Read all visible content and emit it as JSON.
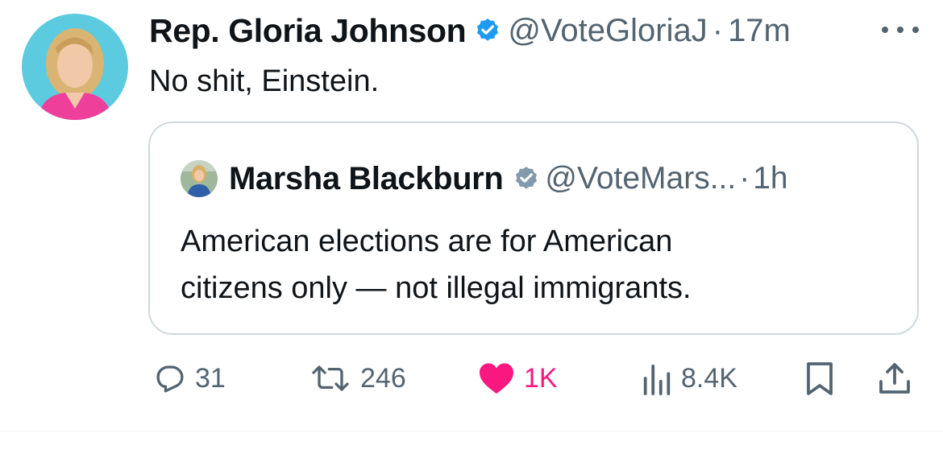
{
  "tweet": {
    "author_name": "Rep. Gloria Johnson",
    "handle": "@VoteGloriaJ",
    "separator": "·",
    "time": "17m",
    "text": "No shit, Einstein."
  },
  "quoted_tweet": {
    "author_name": "Marsha Blackburn",
    "handle": "@VoteMars...",
    "separator": "·",
    "time": "1h",
    "text_line1": "American elections are for American",
    "text_line2": "citizens only — not illegal immigrants."
  },
  "actions": {
    "replies": "31",
    "retweets": "246",
    "likes": "1K",
    "views": "8.4K"
  },
  "icons": {
    "verified": "verified-badge-icon",
    "more": "more-icon",
    "reply": "reply-icon",
    "retweet": "retweet-icon",
    "like": "heart-icon",
    "views": "views-icon",
    "bookmark": "bookmark-icon",
    "share": "share-icon"
  },
  "colors": {
    "verified_blue": "#1d9bf0",
    "verified_gray": "#829aab",
    "like_pink": "#f91880",
    "secondary_text": "#536471",
    "border": "#cfd9de"
  }
}
